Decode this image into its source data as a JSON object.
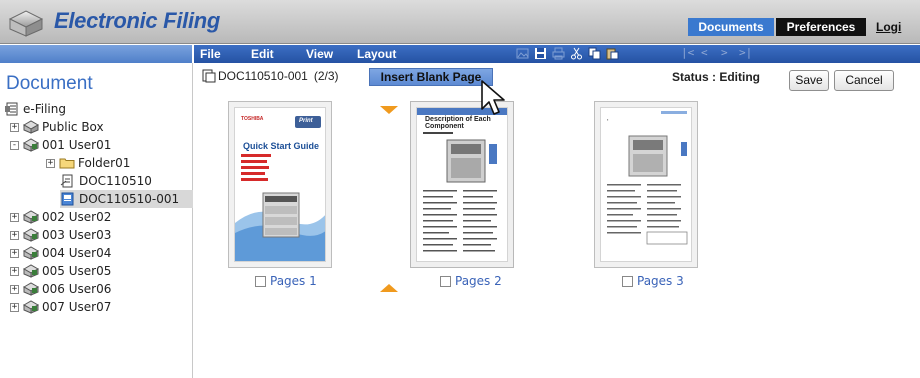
{
  "app": {
    "title": "Electronic Filing",
    "tabs": {
      "documents": "Documents",
      "preferences": "Preferences",
      "logout": "Logi"
    }
  },
  "menu": {
    "items": [
      "File",
      "Edit",
      "View",
      "Layout"
    ],
    "toolbar_icons": [
      "image-icon",
      "save-icon",
      "print-icon",
      "cut-icon",
      "copy-icon",
      "paste-icon"
    ],
    "nav": [
      "|<",
      "<",
      ">",
      ">|"
    ]
  },
  "sidebar": {
    "title": "Document",
    "tree": [
      {
        "label": "e-Filing",
        "icon": "efiling-root-icon"
      },
      {
        "label": "Public Box",
        "icon": "public-box-icon",
        "expander": "+"
      },
      {
        "label": "001 User01",
        "icon": "user-box-icon",
        "expander": "-"
      },
      {
        "label": "Folder01",
        "icon": "folder-icon",
        "expander": "+"
      },
      {
        "label": "DOC110510",
        "icon": "document-icon"
      },
      {
        "label": "DOC110510-001",
        "icon": "document-editing-icon",
        "selected": true
      },
      {
        "label": "002 User02",
        "icon": "user-box-icon",
        "expander": "+"
      },
      {
        "label": "003 User03",
        "icon": "user-box-icon",
        "expander": "+"
      },
      {
        "label": "004 User04",
        "icon": "user-box-icon",
        "expander": "+"
      },
      {
        "label": "005 User05",
        "icon": "user-box-icon",
        "expander": "+"
      },
      {
        "label": "006 User06",
        "icon": "user-box-icon",
        "expander": "+"
      },
      {
        "label": "007 User07",
        "icon": "user-box-icon",
        "expander": "+"
      }
    ]
  },
  "editor": {
    "doc_title": "DOC110510-001",
    "doc_pages": "(2/3)",
    "insert_blank": "Insert Blank Page",
    "status": "Status : Editing",
    "save": "Save",
    "cancel": "Cancel"
  },
  "pages": [
    {
      "label": "Pages 1",
      "heading": "Quick Start Guide",
      "brand": "TOSHIBA",
      "badge": "Print"
    },
    {
      "label": "Pages 2",
      "heading": "Description of Each Component"
    },
    {
      "label": "Pages 3"
    }
  ],
  "colors": {
    "accent": "#3a79cf",
    "marker": "#f09a1e",
    "link": "#3a63b8"
  }
}
